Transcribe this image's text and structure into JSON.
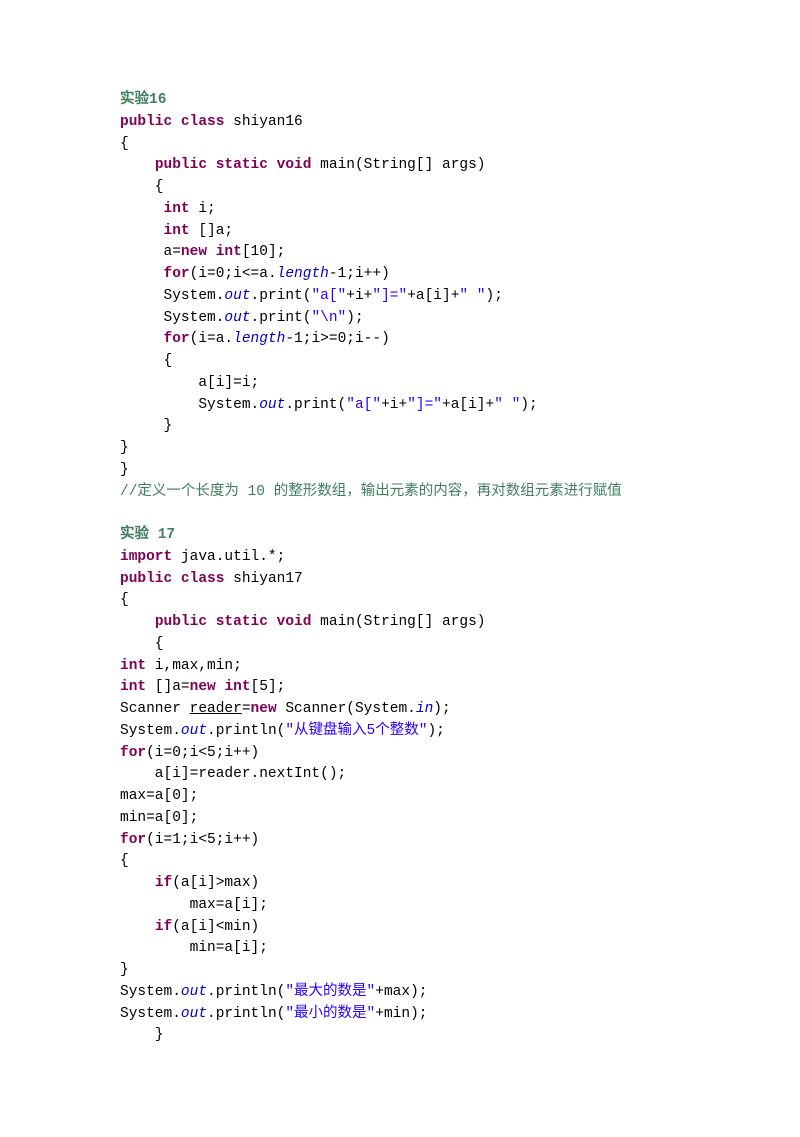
{
  "sections": [
    {
      "title": "实验16",
      "lines": [
        [
          {
            "t": "public",
            "c": "kw"
          },
          {
            "t": " "
          },
          {
            "t": "class",
            "c": "kw"
          },
          {
            "t": " shiyan16"
          }
        ],
        [
          {
            "t": "{"
          }
        ],
        [
          {
            "t": "    "
          },
          {
            "t": "public",
            "c": "kw"
          },
          {
            "t": " "
          },
          {
            "t": "static",
            "c": "kw"
          },
          {
            "t": " "
          },
          {
            "t": "void",
            "c": "kw"
          },
          {
            "t": " main(String[] args)"
          }
        ],
        [
          {
            "t": "    {"
          }
        ],
        [
          {
            "t": "     "
          },
          {
            "t": "int",
            "c": "kw"
          },
          {
            "t": " i;"
          }
        ],
        [
          {
            "t": "     "
          },
          {
            "t": "int",
            "c": "kw"
          },
          {
            "t": " []a;"
          }
        ],
        [
          {
            "t": "     a="
          },
          {
            "t": "new",
            "c": "kw"
          },
          {
            "t": " "
          },
          {
            "t": "int",
            "c": "kw"
          },
          {
            "t": "[10];"
          }
        ],
        [
          {
            "t": "     "
          },
          {
            "t": "for",
            "c": "kw"
          },
          {
            "t": "(i=0;i<=a."
          },
          {
            "t": "length",
            "c": "fld"
          },
          {
            "t": "-1;i++)"
          }
        ],
        [
          {
            "t": "     System."
          },
          {
            "t": "out",
            "c": "fld"
          },
          {
            "t": ".print("
          },
          {
            "t": "\"a[\"",
            "c": "str"
          },
          {
            "t": "+i+"
          },
          {
            "t": "\"]=\"",
            "c": "str"
          },
          {
            "t": "+a[i]+"
          },
          {
            "t": "\" \"",
            "c": "str"
          },
          {
            "t": ");"
          }
        ],
        [
          {
            "t": "     System."
          },
          {
            "t": "out",
            "c": "fld"
          },
          {
            "t": ".print("
          },
          {
            "t": "\"\\n\"",
            "c": "str"
          },
          {
            "t": ");"
          }
        ],
        [
          {
            "t": "     "
          },
          {
            "t": "for",
            "c": "kw"
          },
          {
            "t": "(i=a."
          },
          {
            "t": "length",
            "c": "fld"
          },
          {
            "t": "-1;i>=0;i--)"
          }
        ],
        [
          {
            "t": "     {"
          }
        ],
        [
          {
            "t": "         a[i]=i;"
          }
        ],
        [
          {
            "t": "         System."
          },
          {
            "t": "out",
            "c": "fld"
          },
          {
            "t": ".print("
          },
          {
            "t": "\"a[\"",
            "c": "str"
          },
          {
            "t": "+i+"
          },
          {
            "t": "\"]=\"",
            "c": "str"
          },
          {
            "t": "+a[i]+"
          },
          {
            "t": "\" \"",
            "c": "str"
          },
          {
            "t": ");"
          }
        ],
        [
          {
            "t": "     }"
          }
        ],
        [
          {
            "t": "}"
          }
        ],
        [
          {
            "t": "}"
          }
        ]
      ],
      "comment": "//定义一个长度为 10 的整形数组，输出元素的内容，再对数组元素进行赋值"
    },
    {
      "title": "实验 17",
      "lines": [
        [
          {
            "t": "import",
            "c": "kw"
          },
          {
            "t": " java.util.*;"
          }
        ],
        [
          {
            "t": "public",
            "c": "kw"
          },
          {
            "t": " "
          },
          {
            "t": "class",
            "c": "kw"
          },
          {
            "t": " shiyan17"
          }
        ],
        [
          {
            "t": "{"
          }
        ],
        [
          {
            "t": "    "
          },
          {
            "t": "public",
            "c": "kw"
          },
          {
            "t": " "
          },
          {
            "t": "static",
            "c": "kw"
          },
          {
            "t": " "
          },
          {
            "t": "void",
            "c": "kw"
          },
          {
            "t": " main(String[] args)"
          }
        ],
        [
          {
            "t": "    {"
          }
        ],
        [
          {
            "t": "int",
            "c": "kw"
          },
          {
            "t": " i,max,min;"
          }
        ],
        [
          {
            "t": "int",
            "c": "kw"
          },
          {
            "t": " []a="
          },
          {
            "t": "new",
            "c": "kw"
          },
          {
            "t": " "
          },
          {
            "t": "int",
            "c": "kw"
          },
          {
            "t": "[5];"
          }
        ],
        [
          {
            "t": "Scanner "
          },
          {
            "t": "reader",
            "c": "u"
          },
          {
            "t": "="
          },
          {
            "t": "new",
            "c": "kw"
          },
          {
            "t": " Scanner(System."
          },
          {
            "t": "in",
            "c": "fld"
          },
          {
            "t": ");"
          }
        ],
        [
          {
            "t": "System."
          },
          {
            "t": "out",
            "c": "fld"
          },
          {
            "t": ".println("
          },
          {
            "t": "\"从键盘输入5个整数\"",
            "c": "str"
          },
          {
            "t": ");"
          }
        ],
        [
          {
            "t": "for",
            "c": "kw"
          },
          {
            "t": "(i=0;i<5;i++)"
          }
        ],
        [
          {
            "t": "    a[i]=reader.nextInt();"
          }
        ],
        [
          {
            "t": "max=a[0];"
          }
        ],
        [
          {
            "t": "min=a[0];"
          }
        ],
        [
          {
            "t": "for",
            "c": "kw"
          },
          {
            "t": "(i=1;i<5;i++)"
          }
        ],
        [
          {
            "t": "{"
          }
        ],
        [
          {
            "t": "    "
          },
          {
            "t": "if",
            "c": "kw"
          },
          {
            "t": "(a[i]>max)"
          }
        ],
        [
          {
            "t": "        max=a[i];"
          }
        ],
        [
          {
            "t": "    "
          },
          {
            "t": "if",
            "c": "kw"
          },
          {
            "t": "(a[i]<min)"
          }
        ],
        [
          {
            "t": "        min=a[i];"
          }
        ],
        [
          {
            "t": "}"
          }
        ],
        [
          {
            "t": "System."
          },
          {
            "t": "out",
            "c": "fld"
          },
          {
            "t": ".println("
          },
          {
            "t": "\"最大的数是\"",
            "c": "str"
          },
          {
            "t": "+max);"
          }
        ],
        [
          {
            "t": "System."
          },
          {
            "t": "out",
            "c": "fld"
          },
          {
            "t": ".println("
          },
          {
            "t": "\"最小的数是\"",
            "c": "str"
          },
          {
            "t": "+min);"
          }
        ],
        [
          {
            "t": "    }"
          }
        ]
      ]
    }
  ]
}
